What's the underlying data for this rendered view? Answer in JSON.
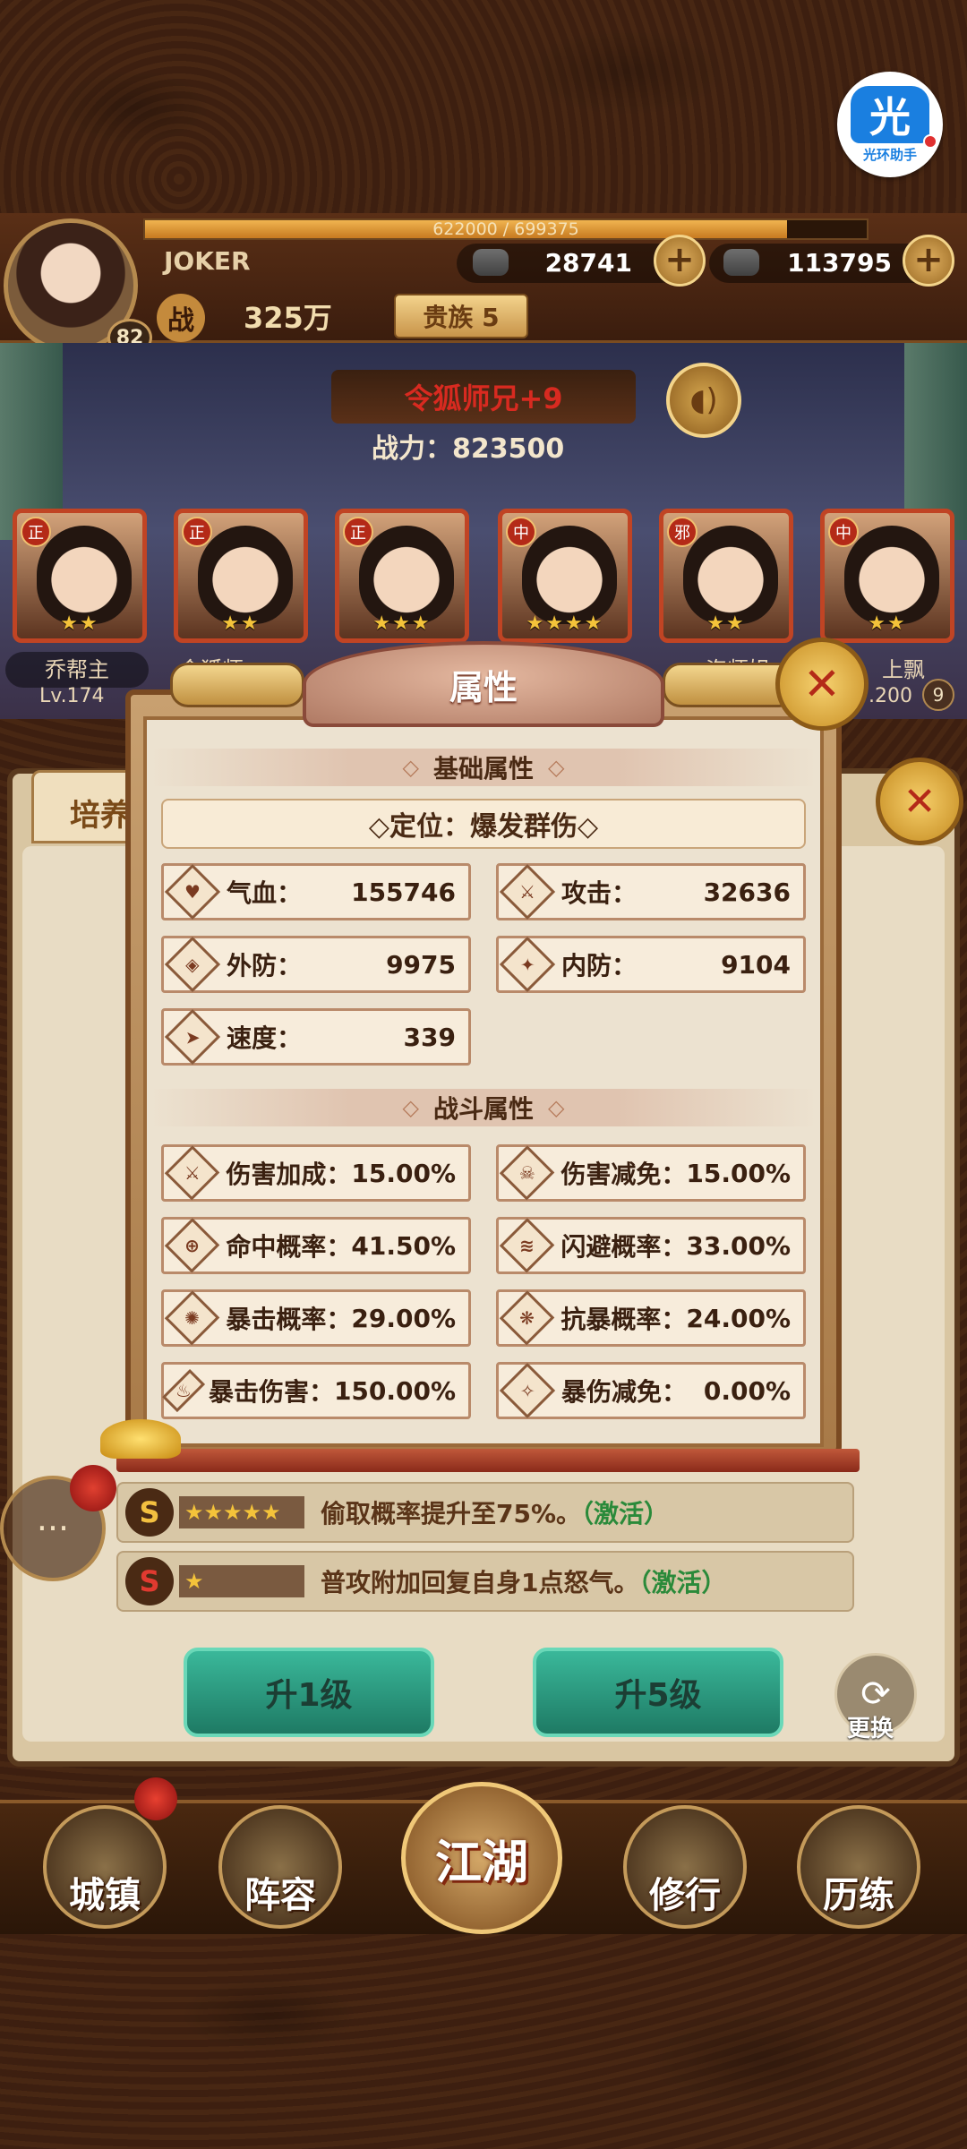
{
  "assistant": {
    "glyph": "光",
    "label": "光环助手"
  },
  "player": {
    "name": "JOKER",
    "level": "82",
    "exp_text": "622000 / 699375",
    "exp_fraction": 0.889,
    "gold": "28741",
    "silver": "113795",
    "power_icon": "战",
    "power": "325万",
    "noble": "贵族 5"
  },
  "hero": {
    "name": "令狐师兄+9",
    "combat_power": "战力：823500"
  },
  "team": {
    "cards": [
      {
        "tag": "正",
        "stars": "★★"
      },
      {
        "tag": "正",
        "stars": "★★"
      },
      {
        "tag": "正",
        "stars": "★★★"
      },
      {
        "tag": "中",
        "stars": "★★★★"
      },
      {
        "tag": "邪",
        "stars": "★★"
      },
      {
        "tag": "中",
        "stars": "★★"
      }
    ],
    "left_name": "乔帮主",
    "left_level": "Lv.174",
    "partial_name_2": "令狐师",
    "partial_name_5": "恣师姐",
    "right_name": "上飘",
    "right_level": ".200",
    "right_badge": "9"
  },
  "modal": {
    "title": "属性",
    "close_glyph": "✕",
    "basic_header": "基础属性",
    "role": "◇定位：爆发群伤◇",
    "basic_stats": [
      {
        "icon": "♥",
        "label": "气血：",
        "value": "155746"
      },
      {
        "icon": "⚔",
        "label": "攻击：",
        "value": "32636"
      },
      {
        "icon": "◈",
        "label": "外防：",
        "value": "9975"
      },
      {
        "icon": "✦",
        "label": "内防：",
        "value": "9104"
      },
      {
        "icon": "➤",
        "label": "速度：",
        "value": "339"
      }
    ],
    "combat_header": "战斗属性",
    "combat_stats": [
      {
        "icon": "⚔",
        "label": "伤害加成：",
        "value": "15.00%"
      },
      {
        "icon": "☠",
        "label": "伤害减免：",
        "value": "15.00%"
      },
      {
        "icon": "⊕",
        "label": "命中概率：",
        "value": "41.50%"
      },
      {
        "icon": "≋",
        "label": "闪避概率：",
        "value": "33.00%"
      },
      {
        "icon": "✺",
        "label": "暴击概率：",
        "value": "29.00%"
      },
      {
        "icon": "❋",
        "label": "抗暴概率：",
        "value": "24.00%"
      },
      {
        "icon": "♨",
        "label": "暴击伤害：",
        "value": "150.00%"
      },
      {
        "icon": "✧",
        "label": "暴伤减免：",
        "value": "0.00%"
      }
    ]
  },
  "panel": {
    "tab": "培养",
    "skills": [
      {
        "icon": "S",
        "stars": "★★★★★",
        "text": "偷取概率提升至75%。",
        "status": "（激活）"
      },
      {
        "icon": "S",
        "stars": "★",
        "text": "普攻附加回复自身1点怒气。",
        "status": "（激活）"
      }
    ],
    "up1": "升1级",
    "up5": "升5级",
    "swap": "更换"
  },
  "nav": {
    "town": "城镇",
    "lineup": "阵容",
    "jianghu": "江湖",
    "cultivate": "修行",
    "train": "历练"
  }
}
